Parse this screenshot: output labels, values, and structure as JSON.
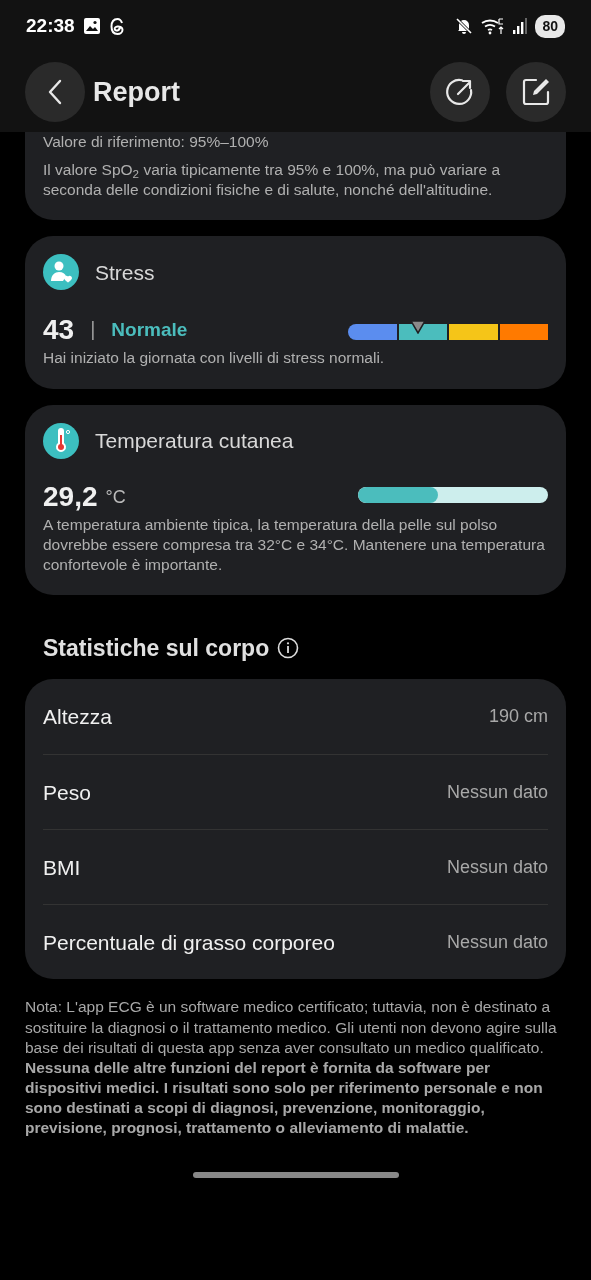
{
  "status_bar": {
    "time": "22:38",
    "battery": "80"
  },
  "header": {
    "title": "Report"
  },
  "spo2_card": {
    "reference": "Valore di riferimento: 95%–100%",
    "description": "Il valore SpO$_{2}$ varia tipicamente tra 95% e 100%, ma può variare a seconda delle condizioni fisiche e di salute, nonché dell'altitudine."
  },
  "stress_card": {
    "title": "Stress",
    "value": "43",
    "separator": "|",
    "status": "Normale",
    "level": 0.35,
    "segments": [
      {
        "color": "#5b8def"
      },
      {
        "color": "#4bbdbd"
      },
      {
        "color": "#f5c518"
      },
      {
        "color": "#ff7a00"
      }
    ],
    "description": "Hai iniziato la giornata con livelli di stress normali."
  },
  "temperature_card": {
    "title": "Temperatura cutanea",
    "value": "29,2",
    "unit": "°C",
    "level": 0.42,
    "description": "A temperatura ambiente tipica, la temperatura della pelle sul polso dovrebbe essere compresa tra 32°C e 34°C. Mantenere una temperatura confortevole è importante."
  },
  "body_stats": {
    "title": "Statistiche sul corpo",
    "rows": [
      {
        "label": "Altezza",
        "value": "190 cm"
      },
      {
        "label": "Peso",
        "value": "Nessun dato"
      },
      {
        "label": "BMI",
        "value": "Nessun dato"
      },
      {
        "label": "Percentuale di grasso corporeo",
        "value": "Nessun dato"
      }
    ]
  },
  "note": "Nota: L'app ECG è un software medico certificato; tuttavia, non è destinato a sostituire la diagnosi o il trattamento medico. Gli utenti non devono agire sulla base dei risultati di questa app senza aver consultato un medico qualificato. **Nessuna delle altre funzioni del report è fornita da software per dispositivi medici. I risultati sono solo per riferimento personale e non sono destinati a scopi di diagnosi, prevenzione, monitoraggio, previsione, prognosi, trattamento o alleviamento di malattie.**"
}
